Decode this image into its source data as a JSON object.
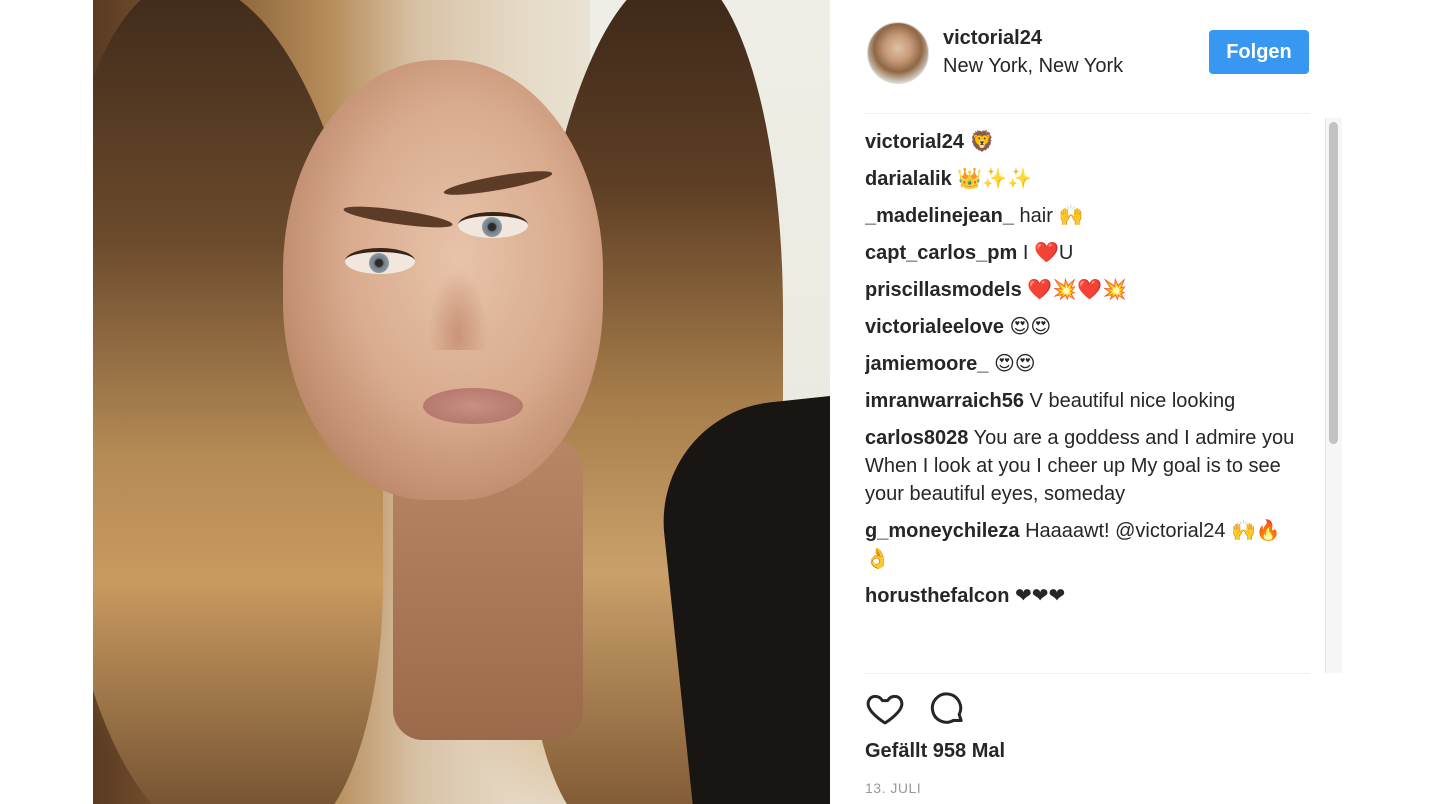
{
  "post": {
    "username": "victorial24",
    "location": "New York, New York",
    "follow_label": "Folgen",
    "likes_text": "Gefällt 958 Mal",
    "date": "13. JULI"
  },
  "comments": [
    {
      "user": "victorial24",
      "text": "🦁"
    },
    {
      "user": "darialalik",
      "text": "👑✨✨"
    },
    {
      "user": "_madelinejean_",
      "text": "hair 🙌"
    },
    {
      "user": "capt_carlos_pm",
      "text": "I ❤️U"
    },
    {
      "user": "priscillasmodels",
      "text": "❤️💥❤️💥"
    },
    {
      "user": "victorialeelove",
      "text": "😍😍"
    },
    {
      "user": "jamiemoore_",
      "text": "😍😍"
    },
    {
      "user": "imranwarraich56",
      "text": "V beautiful nice looking"
    },
    {
      "user": "carlos8028",
      "text": "You are a goddess and I admire you When I look at you I cheer up My goal is to see your beautiful eyes, someday"
    },
    {
      "user": "g_moneychileza",
      "text": "Haaaawt! @victorial24 🙌🔥👌"
    },
    {
      "user": "horusthefalcon",
      "text": "❤❤❤"
    }
  ],
  "icons": {
    "like": "heart-icon",
    "comment": "speech-bubble-icon"
  },
  "colors": {
    "accent": "#3897f0",
    "text": "#262626",
    "muted": "#999999"
  }
}
